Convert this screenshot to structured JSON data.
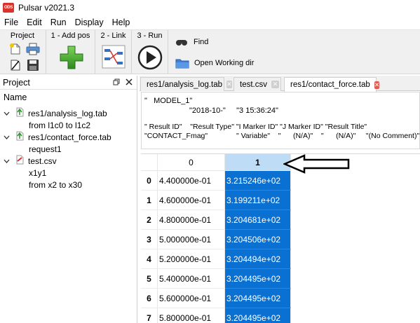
{
  "app": {
    "title": "Pulsar v2021.3",
    "icon_text": "ODS"
  },
  "menu": [
    "File",
    "Edit",
    "Run",
    "Display",
    "Help"
  ],
  "toolbar": {
    "project_label": "Project",
    "add_pos_label": "1 - Add pos",
    "link_label": "2 - Link",
    "run_label": "3 - Run",
    "find_label": "Find",
    "open_dir_label": "Open Working dir"
  },
  "dock": {
    "title": "Project",
    "tree_header": "Name",
    "items": [
      {
        "label": "res1/analysis_log.tab",
        "children": [
          "from l1c0 to l1c2"
        ]
      },
      {
        "label": "res1/contact_force.tab",
        "children": [
          "request1"
        ]
      },
      {
        "label": "test.csv",
        "children": [
          "x1y1",
          "from x2 to x30"
        ]
      }
    ]
  },
  "tabs": [
    {
      "label": "res1/analysis_log.tab",
      "active": false
    },
    {
      "label": "test.csv",
      "active": false
    },
    {
      "label": "res1/contact_force.tab",
      "active": true
    }
  ],
  "header_text": {
    "line1": "\"   MODEL_1\"",
    "line2": "\"2018-10-\"     \"3 15:36:24\"",
    "line3": "\" Result ID\"    \"Result Type\" \"I Marker ID\" \"J Marker ID\" \"Result Title\"",
    "line4": "\"CONTACT_Fmag\"              \" Variable\"    \"      (N/A)\"    \"      (N/A)\"     \"(No Comment)\""
  },
  "table": {
    "columns": [
      "0",
      "1"
    ],
    "rows": [
      {
        "index": "0",
        "c0": "4.400000e-01",
        "c1": "3.215246e+02"
      },
      {
        "index": "1",
        "c0": "4.600000e-01",
        "c1": "3.199211e+02"
      },
      {
        "index": "2",
        "c0": "4.800000e-01",
        "c1": "3.204681e+02"
      },
      {
        "index": "3",
        "c0": "5.000000e-01",
        "c1": "3.204506e+02"
      },
      {
        "index": "4",
        "c0": "5.200000e-01",
        "c1": "3.204494e+02"
      },
      {
        "index": "5",
        "c0": "5.400000e-01",
        "c1": "3.204495e+02"
      },
      {
        "index": "6",
        "c0": "5.600000e-01",
        "c1": "3.204495e+02"
      },
      {
        "index": "7",
        "c0": "5.800000e-01",
        "c1": "3.204495e+02"
      }
    ]
  },
  "colors": {
    "selection": "#0a70d2",
    "selected_header": "#bfdcf6",
    "active_tab_close": "#e05a50"
  }
}
